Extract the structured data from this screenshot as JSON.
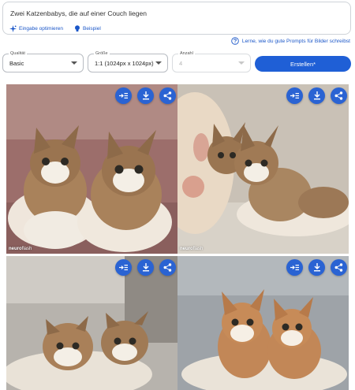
{
  "prompt": {
    "text": "Zwei Katzenbabys, die auf einer Couch liegen",
    "optimize_label": "Eingabe optimieren",
    "example_label": "Beispiel"
  },
  "help": {
    "link_text": "Lerne, wie du gute Prompts für Bilder schreibst"
  },
  "controls": {
    "quality": {
      "label": "Qualität",
      "value": "Basic"
    },
    "size": {
      "label": "Größe",
      "value": "1:1 (1024px x 1024px)"
    },
    "count": {
      "label": "Anzahl",
      "value": "4"
    },
    "create_label": "Erstellen*"
  },
  "images": [
    {
      "watermark_bold": "neuro",
      "watermark_rest": "flash"
    },
    {
      "watermark_bold": "neuro",
      "watermark_rest": "flash"
    },
    {
      "watermark_bold": "",
      "watermark_rest": ""
    },
    {
      "watermark_bold": "",
      "watermark_rest": ""
    }
  ],
  "colors": {
    "accent": "#1f5fd6",
    "icon_button": "#2a63d3",
    "link": "#1a56c8"
  },
  "icons": {
    "insert": "insert-icon",
    "download": "download-icon",
    "share": "share-icon"
  }
}
